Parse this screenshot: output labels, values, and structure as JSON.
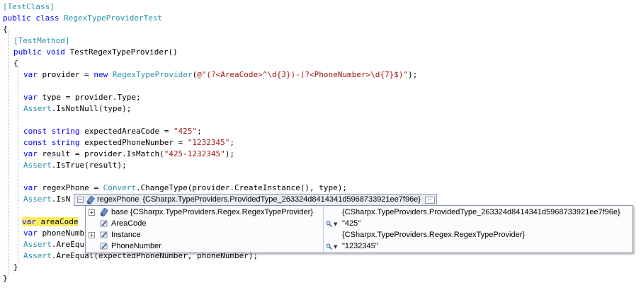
{
  "code": {
    "l1": "[TestClass]",
    "l2_kw": "public class ",
    "l2_ty": "RegexTypeProviderTest",
    "l3": "{",
    "l4": "[TestMethod]",
    "l5_kw": "public void ",
    "l5_rest": "TestRegexTypeProvider()",
    "l6": "{",
    "l7_kw1": "var",
    "l7_a": " provider = ",
    "l7_kw2": "new ",
    "l7_ty": "RegexTypeProvider",
    "l7_b": "(",
    "l7_st": "@\"(?<AreaCode>^\\d{3})-(?<PhoneNumber>\\d{7}$)\"",
    "l7_c": ");",
    "l9_kw": "var",
    "l9_rest": " type = provider.Type;",
    "l10_ty": "Assert",
    "l10_rest": ".IsNotNull(type);",
    "l12_kw": "const string",
    "l12_a": " expectedAreaCode = ",
    "l12_st": "\"425\"",
    "l12_b": ";",
    "l13_kw": "const string",
    "l13_a": " expectedPhoneNumber = ",
    "l13_st": "\"1232345\"",
    "l13_b": ";",
    "l14_kw": "var",
    "l14_a": " result = provider.IsMatch(",
    "l14_st": "\"425-1232345\"",
    "l14_b": ");",
    "l15_ty": "Assert",
    "l15_rest": ".IsTrue(result);",
    "l17_kw": "var",
    "l17_a": " regexPhone = ",
    "l17_ty": "Convert",
    "l17_b": ".ChangeType(provider.CreateInstance(), type);",
    "l18_ty": "Assert",
    "l18_rest": ".IsN",
    "l20_kw": "var",
    "l20_rest": " areaCode",
    "l21_kw": "var",
    "l21_rest": " phoneNumb",
    "l22_ty": "Assert",
    "l22_rest": ".AreEqu",
    "l23_ty": "Assert",
    "l23_rest": ".AreEqual(expectedPhoneNumber, phoneNumber);",
    "l24": "}",
    "l25": "}"
  },
  "datatip": {
    "header_name": "regexPhone",
    "header_value": "{CSharpx.TypeProviders.ProvidedType_263324d8414341d5968733921ee7f96e}",
    "rows": [
      {
        "name": "base {CSharpx.TypeProviders.Regex.RegexTypeProvider}",
        "value": "{CSharpx.TypeProviders.ProvidedType_263324d8414341d5968733921ee7f96e}",
        "icon": "base-class-icon",
        "expandable": true,
        "visualizer": false
      },
      {
        "name": "AreaCode",
        "value": "\"425\"",
        "icon": "property-icon",
        "expandable": false,
        "visualizer": true
      },
      {
        "name": "Instance",
        "value": "{CSharpx.TypeProviders.Regex.RegexTypeProvider}",
        "icon": "property-icon",
        "expandable": true,
        "visualizer": false
      },
      {
        "name": "PhoneNumber",
        "value": "\"1232345\"",
        "icon": "property-icon",
        "expandable": false,
        "visualizer": true
      }
    ]
  }
}
